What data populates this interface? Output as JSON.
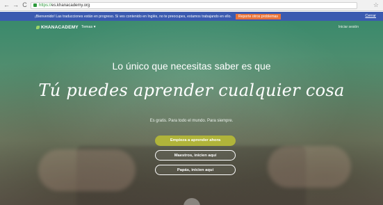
{
  "browser": {
    "url": "https://es.khanacademy.org",
    "url_scheme": "https://",
    "url_host": "es.khanacademy.org"
  },
  "banner": {
    "message": "¡Bienvenido! Las traducciones están en progreso. Si ves contenido en Inglés, no te preocupes, estamos trabajando en ello.",
    "report_label": "Reporte otros problemas",
    "close_label": "Cerrar"
  },
  "nav": {
    "logo_text": "KHANACADEMY",
    "topics_label": "Temas ▾",
    "login_label": "Iniciar sesión"
  },
  "hero": {
    "headline": "Lo único que necesitas saber es que",
    "script_line": "Tú puedes aprender cualquier cosa",
    "subline": "Es gratis. Para todo el mundo. Para siempre.",
    "primary_cta": "Empieza a aprender ahora",
    "teachers_cta": "Maestros, inicien aquí",
    "parents_cta": "Papás, inicien aquí"
  },
  "colors": {
    "banner_bg": "#3b5ab0",
    "report_bg": "#e8733a",
    "primary_cta": "#b0b43a"
  }
}
